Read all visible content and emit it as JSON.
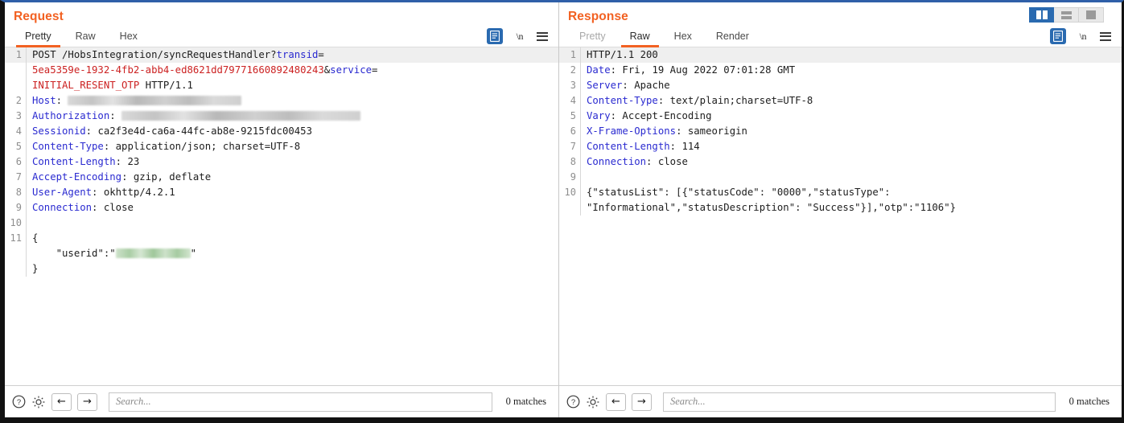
{
  "window": {
    "layout_buttons": [
      {
        "name": "side-by-side-layout",
        "icon": "columns-icon",
        "active": true
      },
      {
        "name": "stacked-layout",
        "icon": "rows-icon",
        "active": false
      },
      {
        "name": "single-pane-layout",
        "icon": "square-icon",
        "active": false
      }
    ]
  },
  "request": {
    "title": "Request",
    "tabs": [
      {
        "label": "Pretty",
        "active": true
      },
      {
        "label": "Raw",
        "active": false
      },
      {
        "label": "Hex",
        "active": false
      }
    ],
    "tools": {
      "wrap_icon": "document-wrap-icon",
      "newline_label": "\\n",
      "menu_icon": "hamburger-menu-icon"
    },
    "lines": [
      {
        "num": "1",
        "highlight": true,
        "parts": [
          {
            "t": "POST /HobsIntegration/syncRequestHandler?",
            "c": "blk"
          },
          {
            "t": "transid",
            "c": "blu"
          },
          {
            "t": "=",
            "c": "blk"
          }
        ]
      },
      {
        "num": "",
        "continuation": true,
        "parts": [
          {
            "t": "5ea5359e-1932-4fb2-abb4-ed8621dd79771660892480243",
            "c": "red"
          },
          {
            "t": "&",
            "c": "blk"
          },
          {
            "t": "service",
            "c": "blu"
          },
          {
            "t": "=",
            "c": "blk"
          }
        ]
      },
      {
        "num": "",
        "continuation": true,
        "parts": [
          {
            "t": "INITIAL_RESENT_OTP",
            "c": "red"
          },
          {
            "t": " HTTP/1.1",
            "c": "blk"
          }
        ]
      },
      {
        "num": "2",
        "parts": [
          {
            "t": "Host",
            "c": "hdr"
          },
          {
            "t": ": ",
            "c": "blk"
          },
          {
            "t": "",
            "c": "blk",
            "redact": 216
          }
        ]
      },
      {
        "num": "3",
        "parts": [
          {
            "t": "Authorization",
            "c": "hdr"
          },
          {
            "t": ": ",
            "c": "blk"
          },
          {
            "t": "",
            "c": "blk",
            "redact": 297
          }
        ]
      },
      {
        "num": "4",
        "parts": [
          {
            "t": "Sessionid",
            "c": "hdr"
          },
          {
            "t": ": ca2f3e4d-ca6a-44fc-ab8e-9215fdc00453",
            "c": "blk"
          }
        ]
      },
      {
        "num": "5",
        "parts": [
          {
            "t": "Content-Type",
            "c": "hdr"
          },
          {
            "t": ": application/json; charset=UTF-8",
            "c": "blk"
          }
        ]
      },
      {
        "num": "6",
        "parts": [
          {
            "t": "Content-Length",
            "c": "hdr"
          },
          {
            "t": ": 23",
            "c": "blk"
          }
        ]
      },
      {
        "num": "7",
        "parts": [
          {
            "t": "Accept-Encoding",
            "c": "hdr"
          },
          {
            "t": ": gzip, deflate",
            "c": "blk"
          }
        ]
      },
      {
        "num": "8",
        "parts": [
          {
            "t": "User-Agent",
            "c": "hdr"
          },
          {
            "t": ": okhttp/4.2.1",
            "c": "blk"
          }
        ]
      },
      {
        "num": "9",
        "parts": [
          {
            "t": "Connection",
            "c": "hdr"
          },
          {
            "t": ": close",
            "c": "blk"
          }
        ]
      },
      {
        "num": "10",
        "parts": []
      },
      {
        "num": "11",
        "parts": [
          {
            "t": "{",
            "c": "blk"
          }
        ]
      },
      {
        "num": "",
        "continuation": true,
        "parts": [
          {
            "t": "    \"userid\":\"",
            "c": "blk"
          },
          {
            "t": "",
            "c": "blk",
            "redact": 93,
            "green": true
          },
          {
            "t": "\"",
            "c": "blk"
          }
        ]
      },
      {
        "num": "",
        "continuation": true,
        "parts": [
          {
            "t": "}",
            "c": "blk"
          }
        ]
      }
    ],
    "footer": {
      "help_icon": "help-circle-icon",
      "settings_icon": "gear-icon",
      "prev_icon": "arrow-left-icon",
      "next_icon": "arrow-right-icon",
      "search_placeholder": "Search...",
      "search_value": "",
      "matches": "0 matches"
    }
  },
  "response": {
    "title": "Response",
    "tabs": [
      {
        "label": "Pretty",
        "active": false,
        "dim": true
      },
      {
        "label": "Raw",
        "active": true
      },
      {
        "label": "Hex",
        "active": false
      },
      {
        "label": "Render",
        "active": false
      }
    ],
    "tools": {
      "wrap_icon": "document-wrap-icon",
      "newline_label": "\\n",
      "menu_icon": "hamburger-menu-icon"
    },
    "lines": [
      {
        "num": "1",
        "highlight": true,
        "parts": [
          {
            "t": "HTTP/1.1 200",
            "c": "blk"
          }
        ]
      },
      {
        "num": "2",
        "parts": [
          {
            "t": "Date",
            "c": "hdr"
          },
          {
            "t": ": Fri, 19 Aug 2022 07:01:28 GMT",
            "c": "blk"
          }
        ]
      },
      {
        "num": "3",
        "parts": [
          {
            "t": "Server",
            "c": "hdr"
          },
          {
            "t": ": Apache",
            "c": "blk"
          }
        ]
      },
      {
        "num": "4",
        "parts": [
          {
            "t": "Content-Type",
            "c": "hdr"
          },
          {
            "t": ": text/plain;charset=UTF-8",
            "c": "blk"
          }
        ]
      },
      {
        "num": "5",
        "parts": [
          {
            "t": "Vary",
            "c": "hdr"
          },
          {
            "t": ": Accept-Encoding",
            "c": "blk"
          }
        ]
      },
      {
        "num": "6",
        "parts": [
          {
            "t": "X-Frame-Options",
            "c": "hdr"
          },
          {
            "t": ": sameorigin",
            "c": "blk"
          }
        ]
      },
      {
        "num": "7",
        "parts": [
          {
            "t": "Content-Length",
            "c": "hdr"
          },
          {
            "t": ": 114",
            "c": "blk"
          }
        ]
      },
      {
        "num": "8",
        "parts": [
          {
            "t": "Connection",
            "c": "hdr"
          },
          {
            "t": ": close",
            "c": "blk"
          }
        ]
      },
      {
        "num": "9",
        "parts": []
      },
      {
        "num": "10",
        "parts": [
          {
            "t": "{\"statusList\": [{\"statusCode\": \"0000\",\"statusType\":",
            "c": "blk"
          }
        ]
      },
      {
        "num": "",
        "continuation": true,
        "parts": [
          {
            "t": "\"Informational\",\"statusDescription\": \"Success\"}],\"otp\":\"1106\"}",
            "c": "blk"
          }
        ]
      }
    ],
    "footer": {
      "help_icon": "help-circle-icon",
      "settings_icon": "gear-icon",
      "prev_icon": "arrow-left-icon",
      "next_icon": "arrow-right-icon",
      "search_placeholder": "Search...",
      "search_value": "",
      "matches": "0 matches"
    }
  },
  "colors": {
    "accent_orange": "#f26122",
    "header_blue": "#2a2ad0",
    "value_red": "#cc2222",
    "active_button_blue": "#2a6ab0"
  }
}
